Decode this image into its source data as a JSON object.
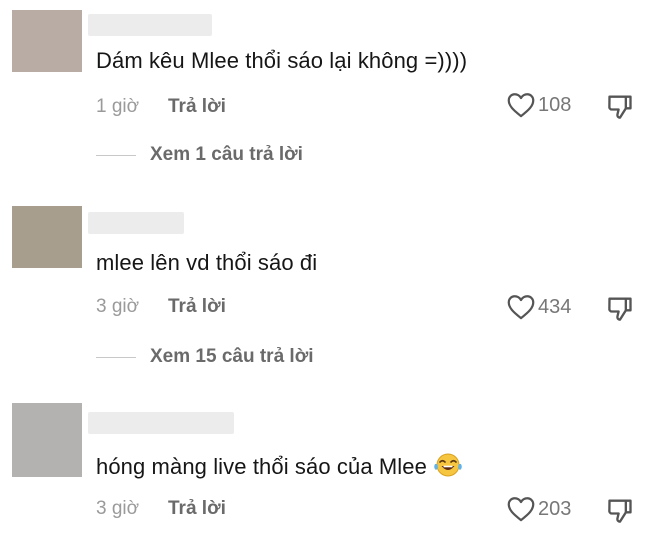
{
  "comments": [
    {
      "text": "Dám kêu Mlee thổi sáo lại không =))))",
      "time": "1 giờ",
      "reply_label": "Trả lời",
      "likes": "108",
      "view_replies": "Xem 1 câu trả lời",
      "avatar_color": "#b8aca5",
      "has_emoji": false
    },
    {
      "text": "mlee lên vd thổi sáo đi",
      "time": "3 giờ",
      "reply_label": "Trả lời",
      "likes": "434",
      "view_replies": "Xem 15 câu trả lời",
      "avatar_color": "#a89e8e",
      "has_emoji": false
    },
    {
      "text": "hóng màng live thổi sáo của Mlee",
      "time": "3 giờ",
      "reply_label": "Trả lời",
      "likes": "203",
      "avatar_color": "#b4b2b1",
      "has_emoji": true,
      "emoji_icon": "face-with-tears-of-joy-icon"
    }
  ],
  "colors": {
    "text": "#161616",
    "muted": "#9a9a9a",
    "action": "#6a6a6a"
  }
}
